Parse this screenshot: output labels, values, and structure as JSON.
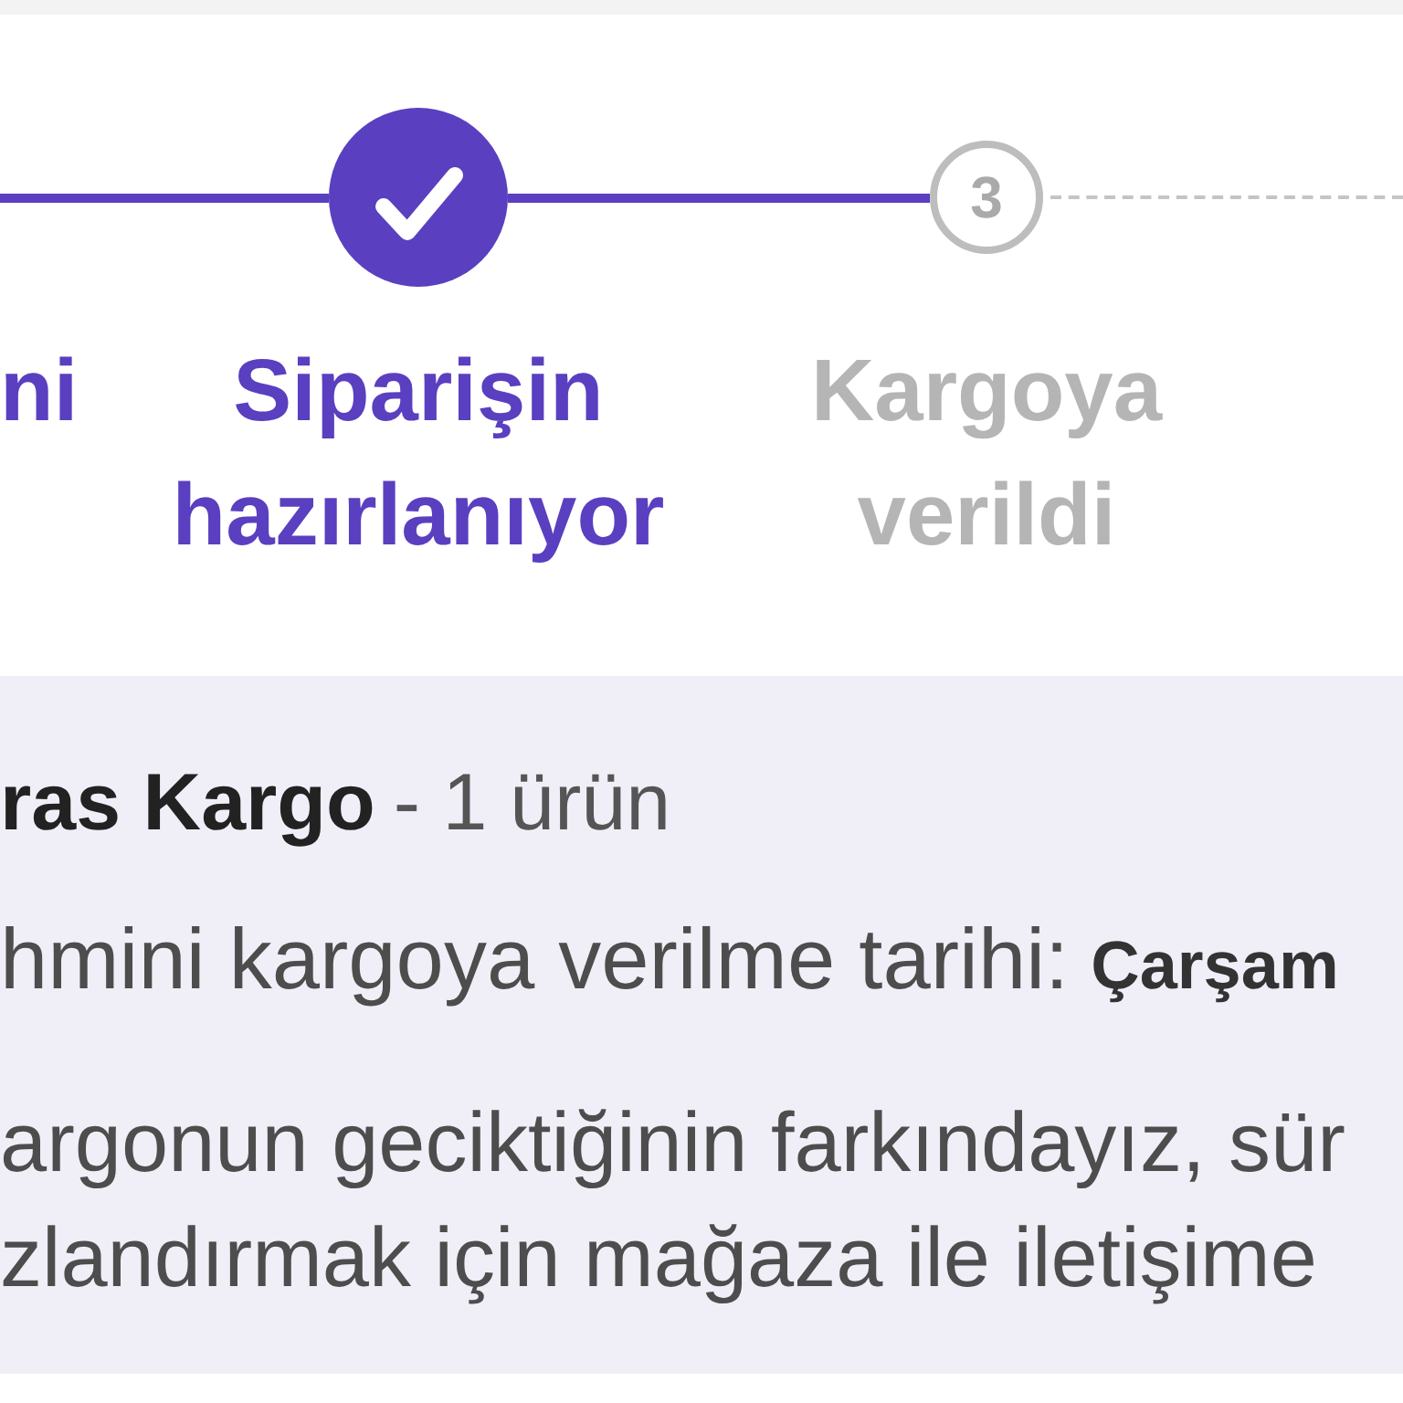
{
  "progress_steps": [
    {
      "label": "ni",
      "completed": true,
      "circle": false
    },
    {
      "label": "Siparişin hazırlanıyor",
      "completed": true,
      "circle": true
    },
    {
      "label": "Kargoya verildi",
      "completed": false,
      "circle": true,
      "number": "3"
    }
  ],
  "shipment": {
    "carrier": "ras Kargo",
    "item_count": "- 1 ürün",
    "estimated_date_label": "hmini kargoya verilme tarihi:",
    "estimated_date": "Çarşam",
    "notice_lines": [
      "argonun geciktiğinin farkındayız, sür",
      "zlandırmak için mağaza ile iletişime"
    ]
  }
}
